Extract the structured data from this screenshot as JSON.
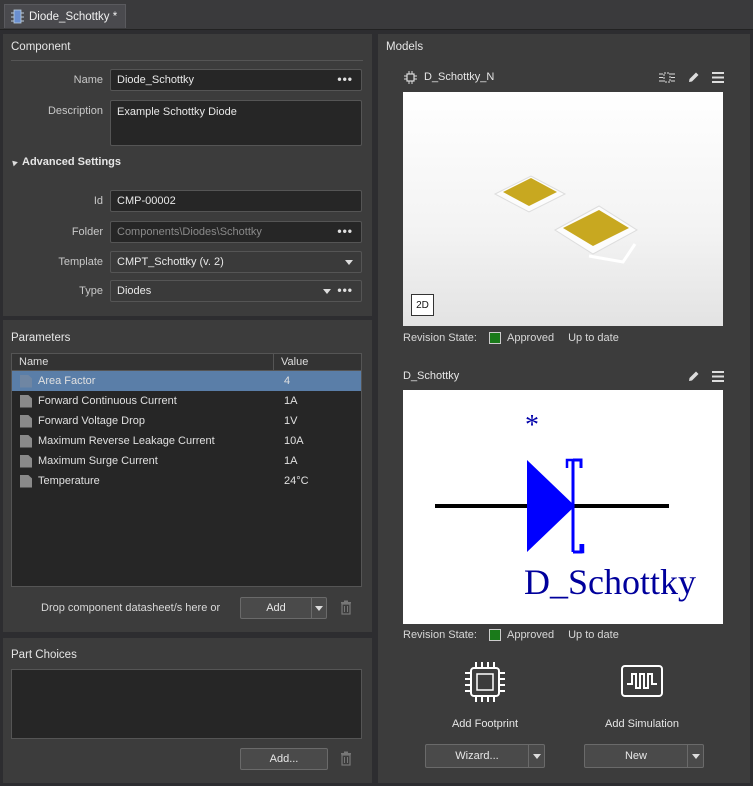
{
  "tab": {
    "title": "Diode_Schottky *"
  },
  "component": {
    "section_title": "Component",
    "name_label": "Name",
    "name_value": "Diode_Schottky",
    "description_label": "Description",
    "description_value": "Example Schottky Diode",
    "advanced_label": "Advanced Settings",
    "id_label": "Id",
    "id_value": "CMP-00002",
    "folder_label": "Folder",
    "folder_value": "Components\\Diodes\\Schottky",
    "template_label": "Template",
    "template_value": "CMPT_Schottky (v. 2)",
    "type_label": "Type",
    "type_value": "Diodes",
    "more_glyph": "•••"
  },
  "parameters": {
    "section_title": "Parameters",
    "col_name": "Name",
    "col_value": "Value",
    "rows": [
      {
        "name": "Area Factor",
        "value": "4"
      },
      {
        "name": "Forward Continuous Current",
        "value": "1A"
      },
      {
        "name": "Forward Voltage Drop",
        "value": "1V"
      },
      {
        "name": "Maximum Reverse Leakage Current",
        "value": "10A"
      },
      {
        "name": "Maximum Surge Current",
        "value": "1A"
      },
      {
        "name": "Temperature",
        "value": "24°C"
      }
    ],
    "drop_hint": "Drop component datasheet/s here or",
    "add_label": "Add"
  },
  "part_choices": {
    "section_title": "Part Choices",
    "add_label": "Add..."
  },
  "models": {
    "section_title": "Models",
    "footprint": {
      "name": "D_Schottky_N",
      "view_badge": "2D",
      "revision_label": "Revision State:",
      "revision_state": "Approved",
      "status": "Up to date"
    },
    "symbol": {
      "name": "D_Schottky",
      "designator_mark": "*",
      "comment_text": "D_Schottky",
      "revision_label": "Revision State:",
      "revision_state": "Approved",
      "status": "Up to date"
    },
    "add_footprint_label": "Add Footprint",
    "add_simulation_label": "Add Simulation",
    "wizard_label": "Wizard...",
    "new_label": "New"
  },
  "colors": {
    "accent_selection": "#5a7ea8",
    "approved": "#1a7a1a",
    "symbol_blue": "#0000ff",
    "pad_gold": "#c8a820"
  }
}
